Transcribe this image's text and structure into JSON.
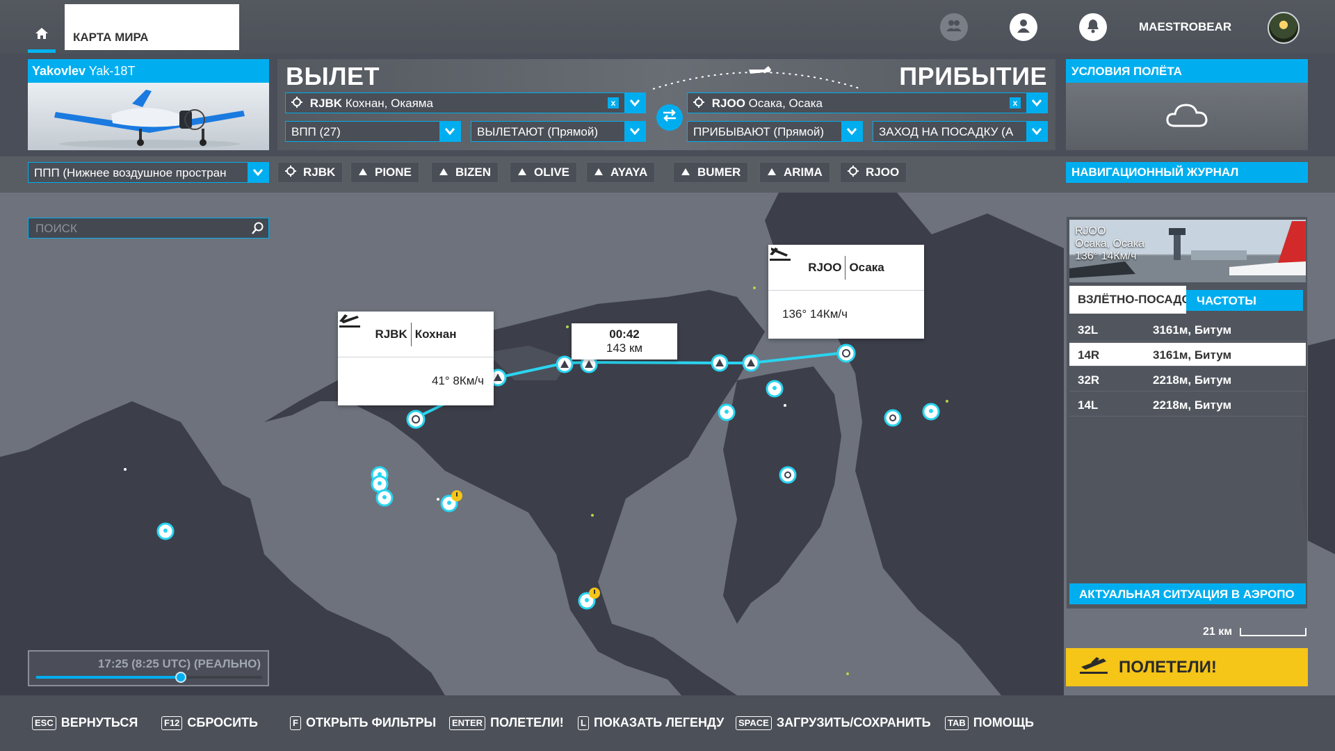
{
  "topbar": {
    "world_tab": "КАРТА МИРА",
    "username": "MAESTROBEAR",
    "icons": [
      "home-icon",
      "friends-icon",
      "profile-icon",
      "notification-icon"
    ]
  },
  "aircraft": {
    "brand": "Yakovlev",
    "model": "Yak-18T"
  },
  "departure": {
    "label": "ВЫЛЕТ",
    "airport_code": "RJBK",
    "airport_name": "Кохнан, Окаяма",
    "runway": "ВПП (27)",
    "procedure": "ВЫЛЕТАЮТ (Прямой)"
  },
  "arrival": {
    "label": "ПРИБЫТИЕ",
    "airport_code": "RJOO",
    "airport_name": "Осака, Осака",
    "procedure": "ПРИБЫВАЮТ (Прямой)",
    "approach": "ЗАХОД НА ПОСАДКУ (А"
  },
  "conditions": {
    "title": "УСЛОВИЯ ПОЛЁТА",
    "icon": "cloud-icon"
  },
  "flight_type": "ППП (Нижнее воздушное простран",
  "waypoints": [
    {
      "name": "RJBK",
      "icon": "airport-icon"
    },
    {
      "name": "PIONE",
      "icon": "waypoint-icon"
    },
    {
      "name": "BIZEN",
      "icon": "waypoint-icon"
    },
    {
      "name": "OLIVE",
      "icon": "waypoint-icon"
    },
    {
      "name": "AYAYA",
      "icon": "waypoint-icon"
    },
    {
      "name": "BUMER",
      "icon": "waypoint-icon"
    },
    {
      "name": "ARIMA",
      "icon": "waypoint-icon"
    },
    {
      "name": "RJOO",
      "icon": "airport-icon"
    }
  ],
  "nav_log": "НАВИГАЦИОННЫЙ ЖУРНАЛ",
  "search": {
    "placeholder": "ПОИСК"
  },
  "callouts": {
    "departure": {
      "code": "RJBK",
      "name": "Кохнан",
      "wind": "41° 8Км/ч"
    },
    "arrival": {
      "code": "RJOO",
      "name": "Осака",
      "wind": "136° 14Км/ч"
    },
    "leg": {
      "time": "00:42",
      "distance": "143 км"
    }
  },
  "airport_panel": {
    "code": "RJOO",
    "name": "Осака, Осака",
    "wind": "136° 14Км/ч",
    "tab_runways": "ВЗЛЁТНО-ПОСАДОЧНЫЕ",
    "tab_frequencies": "ЧАСТОТЫ",
    "runways": [
      {
        "id": "32L",
        "info": "3161м, Битум"
      },
      {
        "id": "14R",
        "info": "3161м, Битум",
        "selected": true
      },
      {
        "id": "32R",
        "info": "2218м, Битум"
      },
      {
        "id": "14L",
        "info": "2218м, Битум"
      }
    ],
    "footer": "АКТУАЛЬНАЯ СИТУАЦИЯ В АЭРОПО"
  },
  "scale": "21 км",
  "fly_button": "ПОЛЕТЕЛИ!",
  "time": {
    "text": "17:25 (8:25 UTC) (РЕАЛЬНО)",
    "progress": 0.64
  },
  "hints": [
    {
      "key": "ESC",
      "label": "ВЕРНУТЬСЯ"
    },
    {
      "key": "F12",
      "label": "СБРОСИТЬ"
    },
    {
      "key": "F",
      "label": "ОТКРЫТЬ ФИЛЬТРЫ"
    },
    {
      "key": "ENTER",
      "label": "ПОЛЕТЕЛИ!"
    },
    {
      "key": "L",
      "label": "ПОКАЗАТЬ ЛЕГЕНДУ"
    },
    {
      "key": "SPACE",
      "label": "ЗАГРУЗИТЬ/СОХРАНИТЬ"
    },
    {
      "key": "TAB",
      "label": "ПОМОЩЬ"
    }
  ],
  "colors": {
    "accent": "#00aeef",
    "fly": "#f5c518",
    "route": "#2ad4f0"
  }
}
